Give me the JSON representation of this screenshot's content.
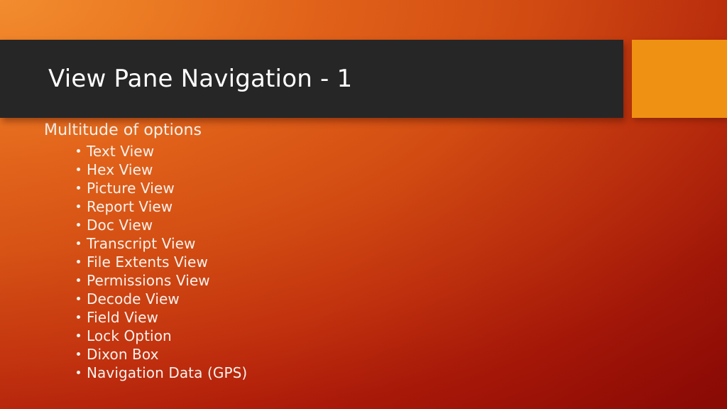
{
  "slide": {
    "title": "View Pane Navigation - 1",
    "lead_line": "Multitude of options",
    "bullets": [
      "Text View",
      "Hex View",
      "Picture View",
      "Report View",
      "Doc View",
      "Transcript View",
      "File Extents View",
      "Permissions View",
      "Decode View",
      "Field View",
      "Lock Option",
      "Dixon Box",
      "Navigation Data (GPS)"
    ],
    "colors": {
      "title_bar": "#262626",
      "accent_square": "#ef9113",
      "title_text": "#ffffff",
      "body_text": "#f7f2ed",
      "background_start": "#ed7d26",
      "background_mid": "#cf4411",
      "background_end": "#9a0c06"
    }
  }
}
